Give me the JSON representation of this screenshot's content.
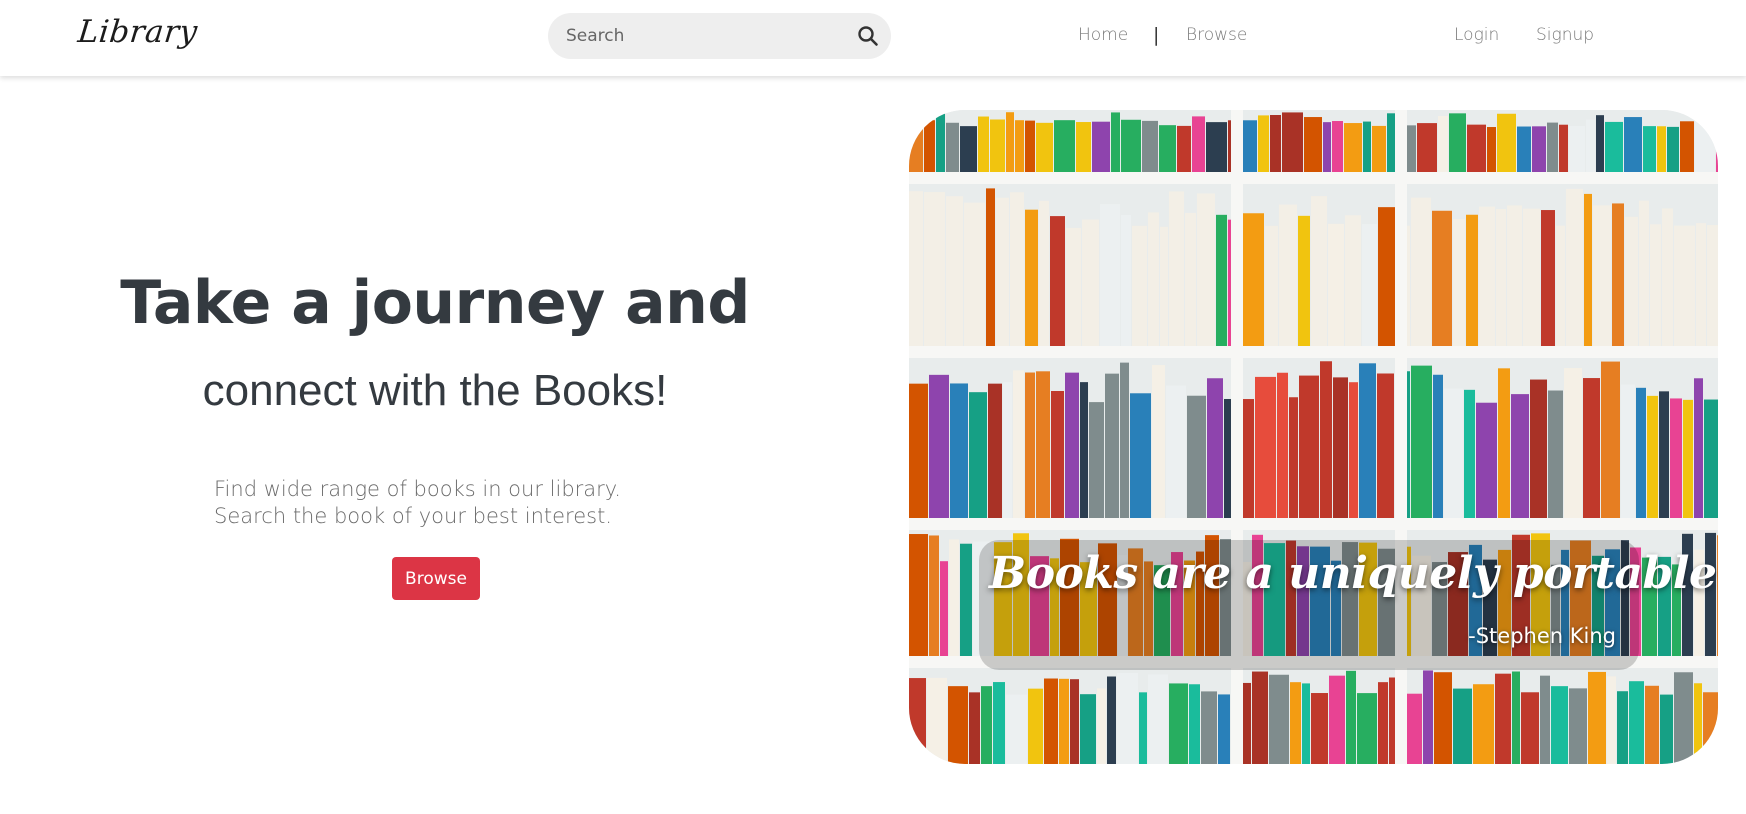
{
  "navbar": {
    "brand": "Library",
    "search": {
      "placeholder": "Search",
      "value": ""
    },
    "links": {
      "home": "Home",
      "separator": "|",
      "browse": "Browse",
      "login": "Login",
      "signup": "Signup"
    }
  },
  "hero": {
    "title_line_1": "Take a journey and",
    "title_line_2": "connect with the Books!",
    "description": "Find wide range of books in our library. Search the book of your best interest.",
    "cta_label": "Browse",
    "cta_color": "#dc3545"
  },
  "image": {
    "quote": "Books are a uniquely portable magic",
    "author": "-Stephen King",
    "book_colors": [
      "#c0392b",
      "#e67e22",
      "#f1c40f",
      "#27ae60",
      "#2980b9",
      "#8e44ad",
      "#ecf0f1",
      "#2c3e50",
      "#d35400",
      "#16a085",
      "#e84393",
      "#f5f0e6",
      "#7f8c8d",
      "#a93226",
      "#1abc9c",
      "#f39c12"
    ]
  },
  "icons": {
    "search": "search-icon"
  }
}
